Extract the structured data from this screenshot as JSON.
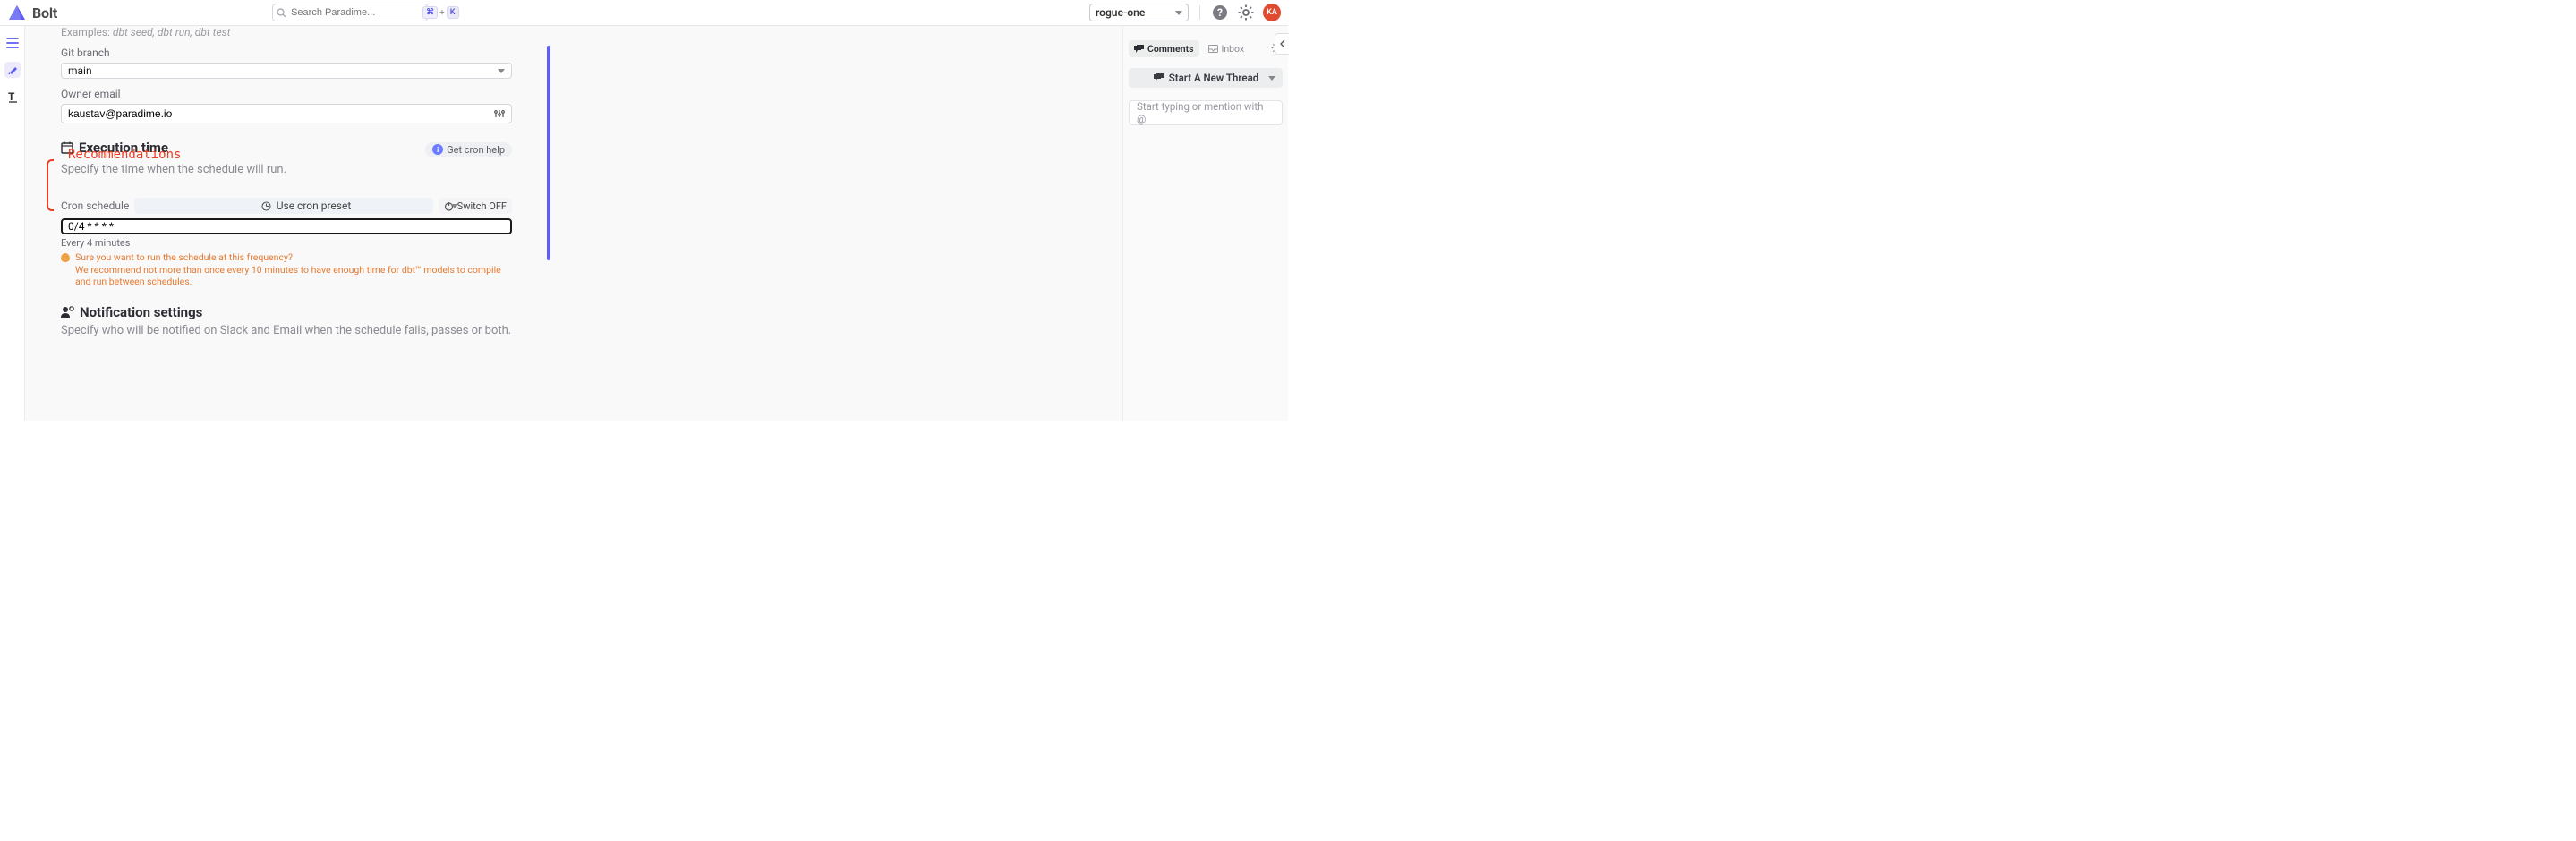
{
  "header": {
    "app_name": "Bolt",
    "search_placeholder": "Search Paradime...",
    "kbd": {
      "k1": "⌘",
      "plus": "+",
      "k2": "K"
    },
    "environment": "rogue-one",
    "avatar_initials": "KA"
  },
  "form": {
    "examples_prefix": "Examples:",
    "examples_text": "dbt seed, dbt run, dbt test",
    "git_branch_label": "Git branch",
    "git_branch_value": "main",
    "owner_email_label": "Owner email",
    "owner_email_value": "kaustav@paradime.io"
  },
  "execution": {
    "title": "Execution time",
    "desc": "Specify the time when the schedule will run.",
    "cron_help": "Get cron help",
    "cron_label": "Cron schedule",
    "preset_label": "Use cron preset",
    "switch_label": "Switch OFF",
    "cron_value": "0/4 * * * *",
    "cron_hint": "Every 4 minutes",
    "warn_line1": "Sure you want to run the schedule at this frequency?",
    "warn_line2": "We recommend not more than once every 10 minutes to have enough time for dbt™ models to compile and run between schedules."
  },
  "annotation": {
    "recommendations": "Recommendations"
  },
  "notifications": {
    "title": "Notification settings",
    "desc": "Specify who will be notified on Slack and Email when the schedule fails, passes or both."
  },
  "comments": {
    "tab_comments": "Comments",
    "tab_inbox": "Inbox",
    "new_thread": "Start A New Thread",
    "compose_placeholder": "Start typing or mention with @"
  }
}
